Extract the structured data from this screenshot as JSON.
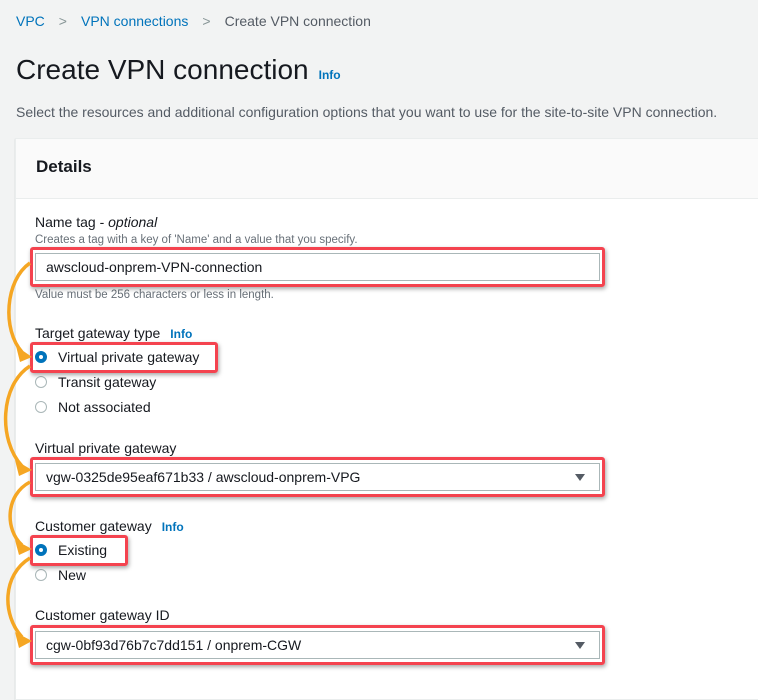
{
  "breadcrumb": {
    "items": [
      "VPC",
      "VPN connections"
    ],
    "current": "Create VPN connection"
  },
  "page": {
    "title": "Create VPN connection",
    "info_link": "Info",
    "description": "Select the resources and additional configuration options that you want to use for the site-to-site VPN connection."
  },
  "details": {
    "heading": "Details",
    "name_tag": {
      "label": "Name tag - ",
      "label_optional": "optional",
      "description": "Creates a tag with a key of 'Name' and a value that you specify.",
      "value": "awscloud-onprem-VPN-connection",
      "constraint": "Value must be 256 characters or less in length."
    },
    "target_gateway_type": {
      "label": "Target gateway type",
      "info_link": "Info",
      "options": [
        "Virtual private gateway",
        "Transit gateway",
        "Not associated"
      ],
      "selected": "Virtual private gateway"
    },
    "virtual_private_gateway": {
      "label": "Virtual private gateway",
      "value": "vgw-0325de95eaf671b33 / awscloud-onprem-VPG"
    },
    "customer_gateway": {
      "label": "Customer gateway",
      "info_link": "Info",
      "options": [
        "Existing",
        "New"
      ],
      "selected": "Existing"
    },
    "customer_gateway_id": {
      "label": "Customer gateway ID",
      "value": "cgw-0bf93d76b7c7dd151 / onprem-CGW"
    }
  },
  "annotations": {
    "highlight_color": "#f4434f",
    "arrow_color": "#f5a623"
  }
}
